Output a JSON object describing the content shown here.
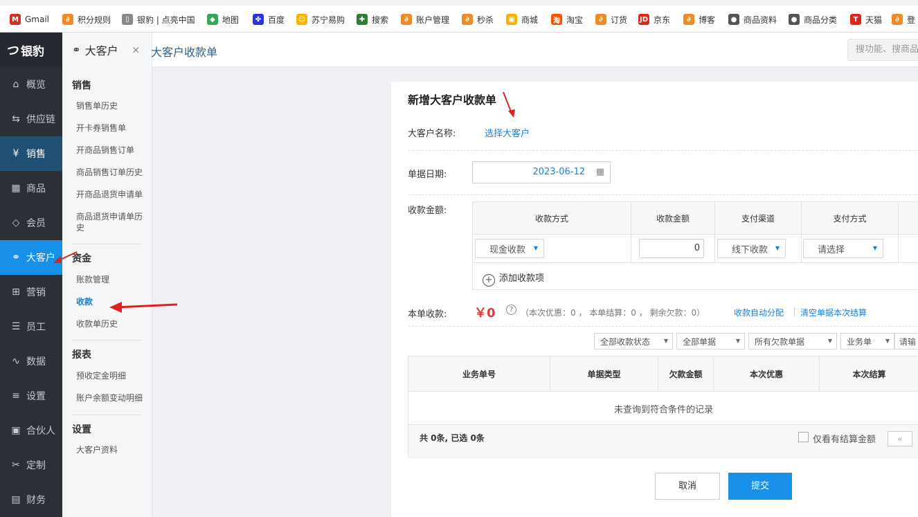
{
  "bookmarks": [
    {
      "label": "Gmail",
      "icon": "gmail-icon",
      "color": "#d93025",
      "glyph": "M"
    },
    {
      "label": "积分规则",
      "icon": "bookmark-icon",
      "color": "#f08a24",
      "glyph": "∂"
    },
    {
      "label": "银豹 | 点亮中国",
      "icon": "page-icon",
      "color": "#888888",
      "glyph": "▯"
    },
    {
      "label": "地图",
      "icon": "map-icon",
      "color": "#34a853",
      "glyph": "◆"
    },
    {
      "label": "百度",
      "icon": "baidu-icon",
      "color": "#2932e1",
      "glyph": "✤"
    },
    {
      "label": "苏宁易购",
      "icon": "suning-icon",
      "color": "#f7b500",
      "glyph": "☺"
    },
    {
      "label": "搜索",
      "icon": "search-engine-icon",
      "color": "#2e7d32",
      "glyph": "✚"
    },
    {
      "label": "账户管理",
      "icon": "bookmark-icon",
      "color": "#f08a24",
      "glyph": "∂"
    },
    {
      "label": "秒杀",
      "icon": "bookmark-icon",
      "color": "#f08a24",
      "glyph": "∂"
    },
    {
      "label": "商城",
      "icon": "shop-icon",
      "color": "#f5b301",
      "glyph": "▣"
    },
    {
      "label": "淘宝",
      "icon": "taobao-icon",
      "color": "#ff5000",
      "glyph": "淘"
    },
    {
      "label": "订货",
      "icon": "bookmark-icon",
      "color": "#f08a24",
      "glyph": "∂"
    },
    {
      "label": "京东",
      "icon": "jd-icon",
      "color": "#e1251b",
      "glyph": "JD"
    },
    {
      "label": "博客",
      "icon": "blog-icon",
      "color": "#f08a24",
      "glyph": "∂"
    },
    {
      "label": "商品资料",
      "icon": "globe-icon",
      "color": "#555555",
      "glyph": "●"
    },
    {
      "label": "商品分类",
      "icon": "globe-icon",
      "color": "#555555",
      "glyph": "●"
    },
    {
      "label": "天猫",
      "icon": "tmall-icon",
      "color": "#e1251b",
      "glyph": "T"
    },
    {
      "label": "登",
      "icon": "bookmark-icon",
      "color": "#f08a24",
      "glyph": "∂"
    }
  ],
  "sidebar": {
    "logo": "银豹",
    "logo_mark": "つ",
    "items": [
      {
        "label": "概览",
        "icon": "home-icon",
        "glyph": "⌂"
      },
      {
        "label": "供应链",
        "icon": "supply-chain-icon",
        "glyph": "⇆"
      },
      {
        "label": "销售",
        "icon": "sales-icon",
        "glyph": "¥"
      },
      {
        "label": "商品",
        "icon": "product-icon",
        "glyph": "▦"
      },
      {
        "label": "会员",
        "icon": "member-icon",
        "glyph": "◇"
      },
      {
        "label": "大客户",
        "icon": "handshake-icon",
        "glyph": "⚭"
      },
      {
        "label": "营销",
        "icon": "marketing-icon",
        "glyph": "⊞"
      },
      {
        "label": "员工",
        "icon": "staff-icon",
        "glyph": "☰"
      },
      {
        "label": "数据",
        "icon": "chart-icon",
        "glyph": "∿"
      },
      {
        "label": "设置",
        "icon": "settings-icon",
        "glyph": "≡"
      },
      {
        "label": "合伙人",
        "icon": "partner-icon",
        "glyph": "▣"
      },
      {
        "label": "定制",
        "icon": "custom-icon",
        "glyph": "✂"
      },
      {
        "label": "财务",
        "icon": "finance-icon",
        "glyph": "▤"
      }
    ]
  },
  "subnav": {
    "title": "大客户",
    "close": "×",
    "sections": [
      {
        "title": "销售",
        "items": [
          "销售单历史",
          "开卡券销售单",
          "开商品销售订单",
          "商品销售订单历史",
          "开商品退货申请单",
          "商品退货申请单历史"
        ]
      },
      {
        "title": "资金",
        "items": [
          "账款管理",
          "收款",
          "收款单历史"
        ]
      },
      {
        "title": "报表",
        "items": [
          "预收定金明细",
          "账户余额变动明细"
        ]
      },
      {
        "title": "设置",
        "items": [
          "大客户资料"
        ]
      }
    ]
  },
  "topbar": {
    "title": "大客户收款单",
    "search_placeholder": "搜功能、搜商品"
  },
  "form": {
    "heading": "新增大客户收款单",
    "customer_label": "大客户名称:",
    "customer_link": "选择大客户",
    "date_label": "单据日期:",
    "date_value": "2023-06-12",
    "amount_label": "收款金额:",
    "pay_table": {
      "headers": [
        "收款方式",
        "收款金额",
        "支付渠道",
        "支付方式"
      ],
      "row": {
        "method": "现金收款",
        "amount": "0",
        "channel": "线下收款",
        "pay_type": "请选择"
      },
      "add_label": "添加收款项"
    },
    "bill_label": "本单收款:",
    "bill_amount": "￥0",
    "bill_help": "?",
    "bill_detail": "（本次优惠：0 ， 本单结算：0 ， 剩余欠款：0）",
    "auto_allocate": "收款自动分配",
    "clear_settle": "清空单据本次结算",
    "filters": [
      "全部收款状态",
      "全部单据",
      "所有欠款单据",
      "业务单",
      "请输"
    ],
    "records_table": {
      "headers": [
        "业务单号",
        "单据类型",
        "欠款金额",
        "本次优惠",
        "本次结算"
      ],
      "empty": "未查询到符合条件的记录",
      "footer": "共 0条, 已选 0条",
      "only_settled": "仅看有结算金额",
      "pager_prev": "«"
    },
    "cancel": "取消",
    "submit": "提交"
  },
  "colors": {
    "accent": "#1890e8",
    "link": "#1c7fd6",
    "red": "#e4393c",
    "sidebar": "#2b2f36"
  }
}
